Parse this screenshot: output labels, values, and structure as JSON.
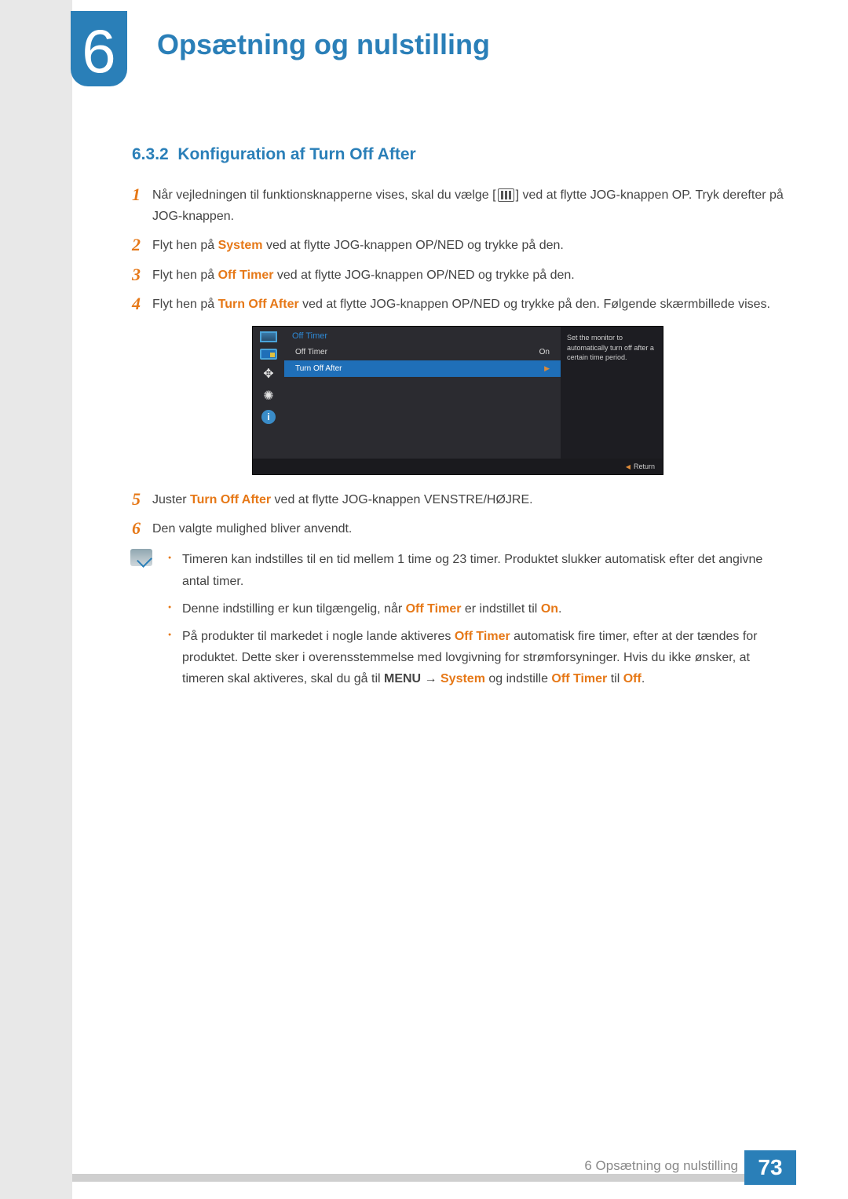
{
  "chapter": {
    "number": "6",
    "title": "Opsætning og nulstilling"
  },
  "section": {
    "number": "6.3.2",
    "title": "Konfiguration af Turn Off After"
  },
  "steps": {
    "s1": {
      "num": "1",
      "text_a": "Når vejledningen til funktionsknapperne vises, skal du vælge [",
      "text_b": "] ved at flytte JOG-knappen OP. Tryk derefter på JOG-knappen."
    },
    "s2": {
      "num": "2",
      "prefix": "Flyt hen på ",
      "hl": "System",
      "suffix": " ved at flytte JOG-knappen OP/NED og trykke på den."
    },
    "s3": {
      "num": "3",
      "prefix": "Flyt hen på ",
      "hl": "Off Timer",
      "suffix": " ved at flytte JOG-knappen OP/NED og trykke på den."
    },
    "s4": {
      "num": "4",
      "prefix": "Flyt hen på ",
      "hl": "Turn Off After",
      "suffix": " ved at flytte JOG-knappen OP/NED og trykke på den. Følgende skærmbillede vises."
    },
    "s5": {
      "num": "5",
      "prefix": "Juster ",
      "hl": "Turn Off After",
      "suffix": " ved at flytte JOG-knappen VENSTRE/HØJRE."
    },
    "s6": {
      "num": "6",
      "text": "Den valgte mulighed bliver anvendt."
    }
  },
  "osd": {
    "header": "Off Timer",
    "item1_label": "Off Timer",
    "item1_value": "On",
    "item2_label": "Turn Off After",
    "desc": "Set the monitor to automatically turn off after a certain time period.",
    "return": "Return"
  },
  "notes": {
    "n1": "Timeren kan indstilles til en tid mellem 1 time og 23 timer. Produktet slukker automatisk efter det angivne antal timer.",
    "n2_a": "Denne indstilling er kun tilgængelig, når ",
    "n2_hl1": "Off Timer",
    "n2_b": " er indstillet til ",
    "n2_hl2": "On",
    "n2_c": ".",
    "n3_a": "På produkter til markedet i nogle lande aktiveres ",
    "n3_hl1": "Off Timer",
    "n3_b": " automatisk fire timer, efter at der tændes for produktet. Dette sker i overensstemmelse med lovgivning for strømforsyninger. Hvis du ikke ønsker, at timeren skal aktiveres, skal du gå til ",
    "n3_menu": "MENU",
    "n3_arrow": " → ",
    "n3_hl2": "System",
    "n3_c": " og indstille ",
    "n3_hl3": "Off Timer",
    "n3_d": " til ",
    "n3_hl4": "Off",
    "n3_e": "."
  },
  "footer": {
    "text": "6 Opsætning og nulstilling",
    "page": "73"
  }
}
